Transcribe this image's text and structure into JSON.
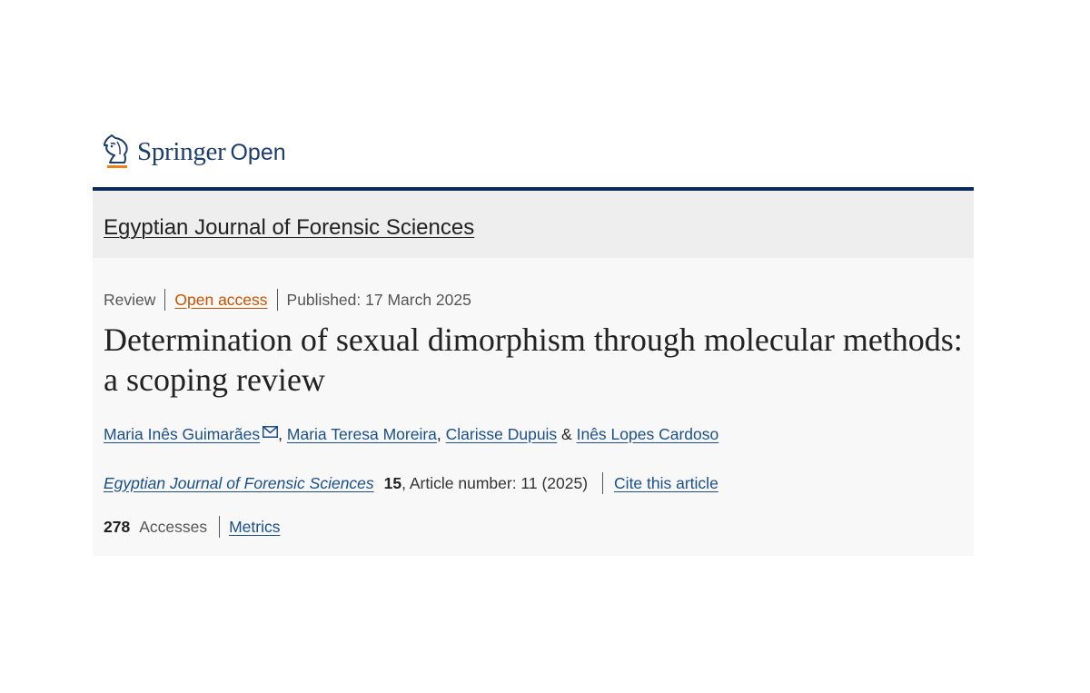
{
  "brand": {
    "name_primary": "Springer",
    "name_secondary": "Open",
    "icon": "springer-horse-icon",
    "colors": {
      "navy": "#1d3d6d",
      "accent": "#f07f1a"
    }
  },
  "journal": {
    "title": "Egyptian Journal of Forensic Sciences"
  },
  "article": {
    "type": "Review",
    "access": "Open access",
    "published": "Published: 17 March 2025",
    "title": "Determination of sexual dimorphism through molecular methods: a scoping review",
    "authors": [
      {
        "name": "Maria Inês Guimarães",
        "separator": ", ",
        "corresponding": true
      },
      {
        "name": "Maria Teresa Moreira",
        "separator": ", ",
        "corresponding": false
      },
      {
        "name": "Clarisse Dupuis",
        "separator": " & ",
        "corresponding": false
      },
      {
        "name": "Inês Lopes Cardoso",
        "separator": "",
        "corresponding": false
      }
    ],
    "citation": {
      "journal": "Egyptian Journal of Forensic Sciences",
      "volume": "15",
      "article_number": ", Article number: 11 (2025)",
      "cite_link": "Cite this article"
    },
    "metrics": {
      "accesses": "278",
      "accesses_label": "Accesses",
      "metrics_link": "Metrics"
    }
  },
  "colors": {
    "link": "#1a4f8b",
    "open_access": "#c65301",
    "rule": "#0c2a5a"
  }
}
